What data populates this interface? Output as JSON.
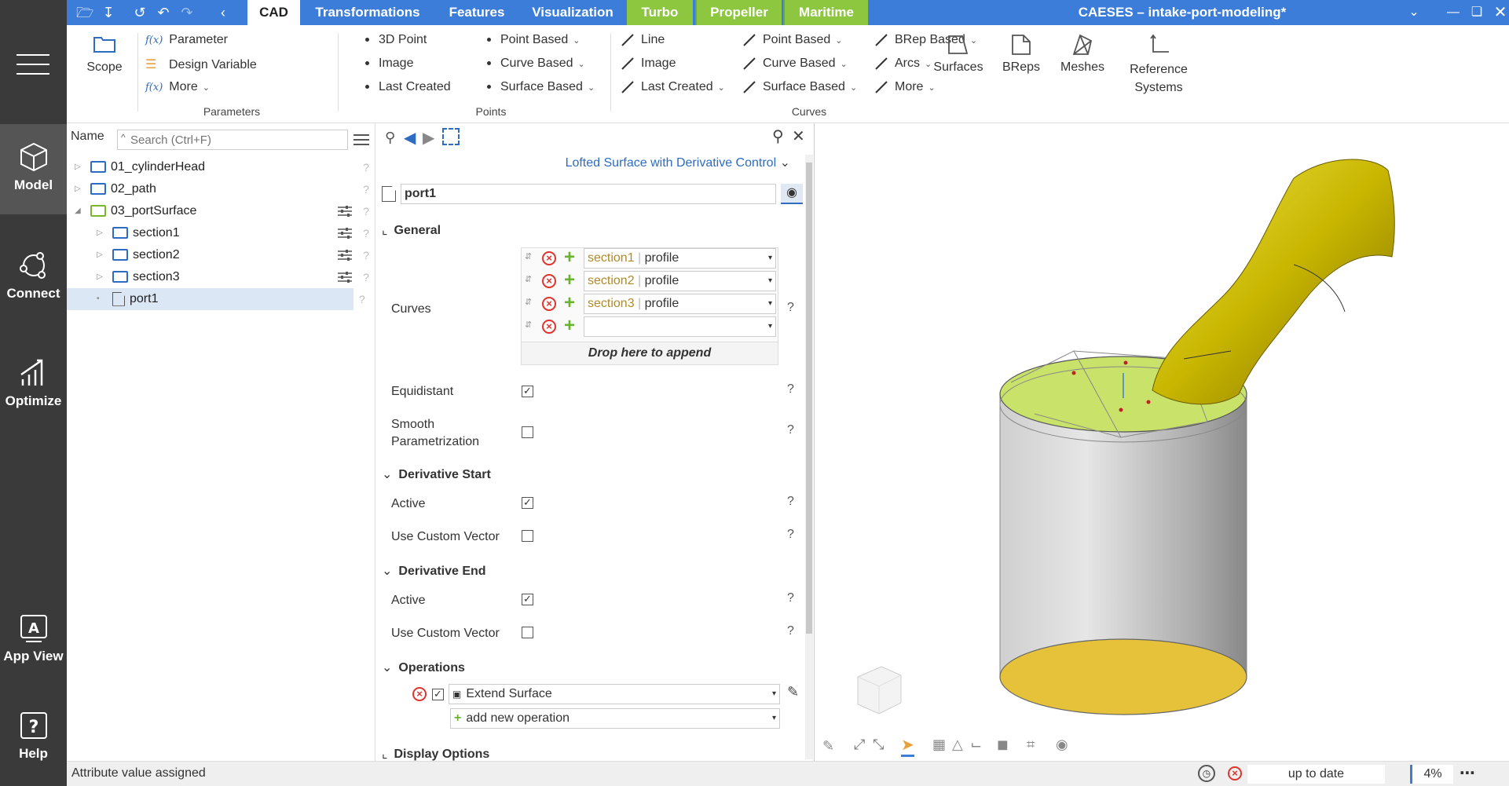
{
  "nav": {
    "items": [
      {
        "label": "Model",
        "icon": "cube-icon"
      },
      {
        "label": "Connect",
        "icon": "connect-icon"
      },
      {
        "label": "Optimize",
        "icon": "chart-icon"
      },
      {
        "label": "App View",
        "icon": "app-view-icon"
      },
      {
        "label": "Help",
        "icon": "help-icon"
      }
    ]
  },
  "titlebar": {
    "tabs": [
      "CAD",
      "Transformations",
      "Features",
      "Visualization",
      "Turbo",
      "Propeller",
      "Maritime"
    ],
    "title": "CAESES – intake-port-modeling*"
  },
  "ribbon": {
    "scope": "Scope",
    "parameters": {
      "items": [
        "Parameter",
        "Design Variable",
        "More"
      ],
      "group": "Parameters"
    },
    "points": {
      "col1": [
        "3D Point",
        "Image",
        "Last Created"
      ],
      "col2": [
        "Point Based",
        "Curve Based",
        "Surface Based"
      ],
      "group": "Points"
    },
    "curves": {
      "col1": [
        "Line",
        "Image",
        "Last Created"
      ],
      "col2": [
        "Point Based",
        "Curve Based",
        "Surface Based"
      ],
      "col3": [
        "BRep Based",
        "Arcs",
        "More"
      ],
      "group": "Curves"
    },
    "big": [
      "Surfaces",
      "BReps",
      "Meshes",
      "Reference Systems"
    ]
  },
  "tree": {
    "name_label": "Name",
    "search_placeholder": "Search (Ctrl+F)",
    "items": [
      "01_cylinderHead",
      "02_path",
      "03_portSurface",
      "section1",
      "section2",
      "section3",
      "port1"
    ]
  },
  "props": {
    "type": "Lofted Surface with Derivative Control",
    "name": "port1",
    "general": "General",
    "curves_label": "Curves",
    "curves": [
      {
        "obj": "section1",
        "attr": "profile"
      },
      {
        "obj": "section2",
        "attr": "profile"
      },
      {
        "obj": "section3",
        "attr": "profile"
      }
    ],
    "drop": "Drop here to append",
    "equidistant": "Equidistant",
    "smooth": "Smooth Parametrization",
    "deriv_start": "Derivative Start",
    "deriv_end": "Derivative End",
    "active": "Active",
    "custom": "Use Custom Vector",
    "operations": "Operations",
    "op1": "Extend Surface",
    "add_op": "add new operation",
    "display": "Display Options"
  },
  "status": {
    "message": "Attribute value assigned",
    "state": "up to date",
    "progress": "4%"
  }
}
